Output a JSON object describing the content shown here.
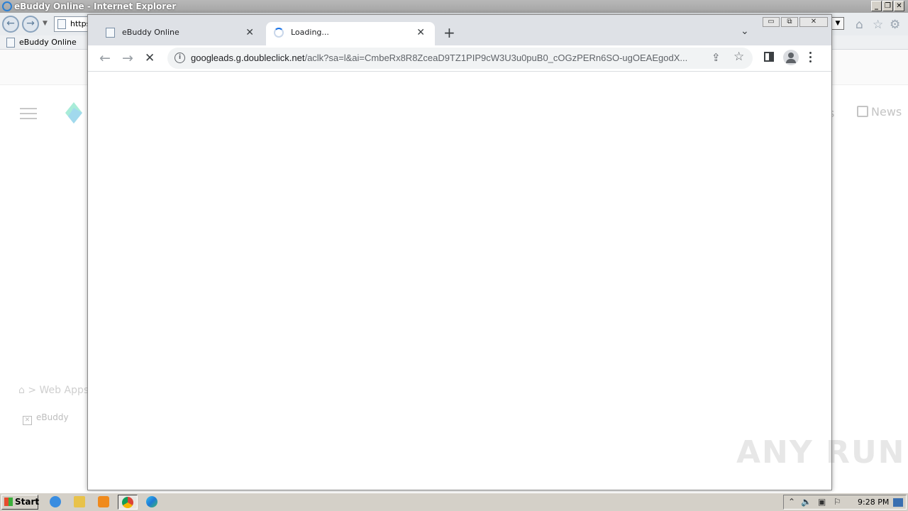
{
  "ie_window": {
    "title": "eBuddy Online - Internet Explorer",
    "address_text": "https",
    "tab_label": "eBuddy Online",
    "window_buttons": [
      "_",
      "❐",
      "✕"
    ]
  },
  "background_page": {
    "nav_news": "News",
    "nav_partial": "s",
    "breadcrumb": "> Web Apps",
    "app_link": "eBuddy"
  },
  "chrome": {
    "tabs": [
      {
        "title": "eBuddy Online",
        "close": "✕"
      },
      {
        "title": "Loading...",
        "close": "✕"
      }
    ],
    "new_tab": "+",
    "tab_search": "⌄",
    "window_buttons": [
      "▭",
      "⧉",
      "✕"
    ],
    "nav": {
      "back": "←",
      "forward": "→",
      "stop": "✕"
    },
    "url_host": "googleads.g.doubleclick.net",
    "url_path": "/aclk?sa=l&ai=CmbeRx8R8ZceaD9TZ1PIP9cW3U3u0puB0_cOGzPERn6SO-ugOEAEgodX...",
    "share_icon": "⇪",
    "star_icon": "☆"
  },
  "watermark": "ANY RUN",
  "taskbar": {
    "start_label": "Start",
    "clock": "9:28 PM",
    "items": [
      "internet-explorer",
      "file-explorer",
      "media-player",
      "chrome",
      "edge"
    ]
  },
  "colors": {
    "chrome_tabstrip": "#dee1e6",
    "omnibox": "#f1f3f4",
    "taskbar": "#d4d0c8",
    "spinner": "#1a73e8"
  }
}
